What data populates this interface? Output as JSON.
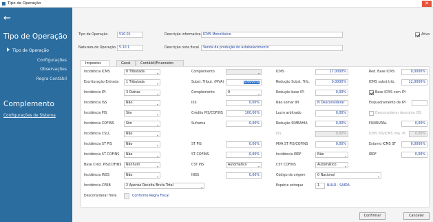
{
  "window": {
    "title": "Tipo de Operação",
    "close_label": "✕"
  },
  "sidebar": {
    "back_icon": "←",
    "heading": "Tipo de Operação",
    "selected": "Tipo de Operação",
    "items": [
      "Configurações",
      "Observações",
      "Regra Contábil"
    ],
    "section2": "Complemento",
    "link": "Configurações de Sistema"
  },
  "header": {
    "tipo_label": "Tipo de Operação",
    "tipo_value": "510.01",
    "desc_label": "Descrição informativa",
    "desc_value": "ICMS Monofásico",
    "natureza_label": "Natureza de Operação",
    "natureza_value": "5.10.1",
    "descnota_label": "Descrição nota fiscal",
    "descnota_value": "Venda de produção do estabelecimento",
    "ativo_label": "Ativo"
  },
  "tabs": [
    "Impostos",
    "Geral",
    "Contábil/Financeiro"
  ],
  "col1": [
    {
      "label": "Incidência ICMS",
      "value": "0 Tributada"
    },
    {
      "label": "Escrituração Entrada",
      "value": "1 Tributada"
    },
    {
      "label": "Incidência IPI",
      "value": "3 Outras"
    },
    {
      "label": "Incidência ISS",
      "value": "Não"
    },
    {
      "label": "Incidência PIS",
      "value": "Sim"
    },
    {
      "label": "Incidência COFINS",
      "value": "Sim"
    },
    {
      "label": "Incidência CSLL",
      "value": "Não"
    },
    {
      "label": "Incidência ST PIS",
      "value": "Não"
    },
    {
      "label": "Incidência ST COFINS",
      "value": "Não"
    },
    {
      "label": "Base Créd. PIS/COFINS",
      "value": "Nenhum"
    },
    {
      "label": "Incidência INSS",
      "value": "Não"
    },
    {
      "label": "Incidência CPRB",
      "value": "2 Apenas Receita Bruta Total"
    },
    {
      "label": "Desconsiderar frete",
      "value": "Conforme Regra Fiscal"
    }
  ],
  "col2": {
    "complemento_label": "Complemento",
    "subst_label": "Subst. Tribut. (MVA)",
    "subst_value": "0,0000%",
    "complemento2_label": "Complemento",
    "complemento2_value": "9",
    "iss_label": "ISS",
    "iss_value": "0,00%",
    "credito_label": "Crédito PIS/COFINS",
    "credito_value": "100,00%",
    "suframa_label": "Suframa",
    "suframa_value": "0,00%",
    "stpis_label": "ST PIS",
    "stpis_value": "0,00%",
    "stcofins_label": "ST COFINS",
    "stcofins_value": "0,00%",
    "cstpis_label": "CST PIS",
    "cstpis_value": "Automático",
    "inss_label": "INSS",
    "inss_value": "0,00%"
  },
  "col3": {
    "icms_label": "ICMS",
    "icms_value": "17,0000%",
    "redsubst_label": "Redução Subst. Trib.",
    "redsubst_value": "0,0000%",
    "redipi_label": "Redução base IPI",
    "redipi_value": "0,00%",
    "naosomar_label": "Não somar IPI",
    "naosomar_value": "N  Desconsiderar",
    "lucro_label": "Lucro arbitrado",
    "lucro_value": "0,00%",
    "redsimb_label": "Redução SIMBAHIA",
    "redsimb_value": "0,00%",
    "iss2_label": "ISS",
    "iss2_value": "0,00%",
    "mva_label": "MVA ST PIS/COFINS",
    "mva_value": "0,00%",
    "irrf_label": "Incidência IRRF",
    "irrf_value": "Não",
    "cstcofins_label": "CST COFINS",
    "cstcofins_value": "Automático",
    "origem_label": "Código de origem",
    "origem_value": "0 Nacional",
    "especie_label": "Espécie estoque",
    "especie_code": "1",
    "especie_value": "NULO - SAIDA"
  },
  "col4": {
    "redbase_label": "Red. Base ICMS",
    "redbase_value": "0,0000%",
    "icmssubst_label": "ICMS subst.trib.",
    "icmssubst_value": "12,0000%",
    "baseicms_label": "Base ICMS com IPI",
    "enquad_label": "Enquadramento de IPI",
    "desconto_label": "Desconsiderar desconto ISS",
    "funrural_label": "FUNRURAL",
    "funrural_value": "0,00%",
    "icmsiss_label": "ICMS ISS/ICMS Imp. Pf.",
    "icmsiss_value": "0,00%",
    "estorno_label": "Estorno ICMS ST",
    "estorno_value": "0,0000%",
    "irrf_label": "IRRF",
    "irrf_value": "0,00%"
  },
  "footer": {
    "confirm": "Confirmar",
    "cancel": "Cancelar"
  }
}
